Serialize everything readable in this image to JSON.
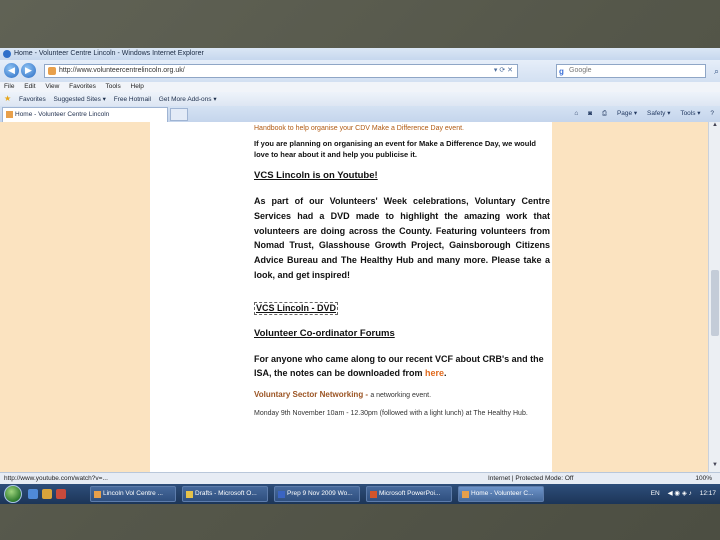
{
  "window": {
    "title": "Home - Volunteer Centre Lincoln - Windows Internet Explorer"
  },
  "address_bar": {
    "url": "http://www.volunteercentrelincoln.org.uk/",
    "search_placeholder": "Google"
  },
  "menu": [
    "File",
    "Edit",
    "View",
    "Favorites",
    "Tools",
    "Help"
  ],
  "favorites_bar": {
    "favorites_label": "Favorites",
    "items": [
      "Suggested Sites ▾",
      "Free Hotmail",
      "Get More Add-ons ▾"
    ]
  },
  "tab": {
    "label": "Home - Volunteer Centre Lincoln"
  },
  "command_bar": [
    "Page ▾",
    "Safety ▾",
    "Tools ▾"
  ],
  "page": {
    "orange_note": "Handbook to help organise your CDV Make a Difference Day event.",
    "para1": "If you are planning on organising an event for Make a Difference Day, we would love to hear about it and help you publicise it.",
    "heading1": "VCS Lincoln is on Youtube!",
    "para2": "As part of our Volunteers' Week celebrations, Voluntary Centre Services had a DVD made to highlight the amazing work that volunteers are doing across the County. Featuring volunteers from Nomad Trust, Glasshouse Growth Project, Gainsborough Citizens Advice Bureau and The Healthy Hub and many more. Please take a look, and get inspired!",
    "dvd_link": "VCS Lincoln - DVD",
    "heading2": "Volunteer Co-ordinator Forums",
    "para3_start": "For anyone who came along to our recent VCF about CRB's and the ISA, the notes can be downloaded from ",
    "para3_link": "here",
    "para3_end": ".",
    "networking_title": "Voluntary Sector Networking - ",
    "networking_sub": "a networking event.",
    "event_line": "Monday 9th November 10am - 12.30pm (followed with a light lunch) at The Healthy Hub."
  },
  "status_bar": {
    "url": "http://www.youtube.com/watch?v=...",
    "zone": "Internet | Protected Mode: Off",
    "zoom": "100%"
  },
  "taskbar": {
    "tasks": [
      {
        "label": "Lincoln Vol Centre ..."
      },
      {
        "label": "Drafts - Microsoft O..."
      },
      {
        "label": "Prep 9 Nov 2009 Wo..."
      },
      {
        "label": "Microsoft PowerPoi..."
      },
      {
        "label": "Home - Volunteer C..."
      }
    ],
    "tray_lang": "EN",
    "clock": "12:17"
  },
  "colors": {
    "content_bg": "#fbe3c0",
    "accent_orange": "#e06a1d",
    "taskbar": "#1c3558"
  }
}
